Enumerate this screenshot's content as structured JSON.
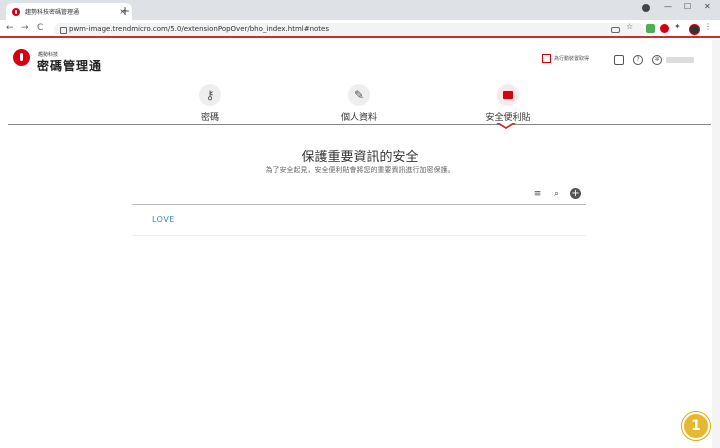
{
  "browser": {
    "tab_title": "趨勢科技密碼管理通",
    "tab_close": "×",
    "new_tab": "+",
    "url": "pwm-image.trendmicro.com/5.0/extensionPopOver/bho_index.html#notes",
    "back": "←",
    "forward": "→",
    "reload": "C",
    "minimize": "—",
    "maximize": "☐",
    "close": "✕"
  },
  "brand": {
    "small_name": "趨勢科技",
    "product_name": "密碼管理通"
  },
  "header": {
    "device_link": "為行動裝置取得"
  },
  "nav": {
    "tabs": [
      {
        "label": "密碼",
        "icon": "key-icon"
      },
      {
        "label": "個人資料",
        "icon": "pen-icon"
      },
      {
        "label": "安全便利貼",
        "icon": "secure-note-icon",
        "active": true
      }
    ]
  },
  "main": {
    "heading": "保護重要資訊的安全",
    "subheading": "為了安全起見，安全便利貼會將您的重要資訊進行加密保護。",
    "notes": [
      {
        "title": "LOVE"
      }
    ]
  },
  "badge": {
    "number": "1"
  },
  "colors": {
    "brand_red": "#d7000f",
    "link_blue": "#3a8bbb",
    "badge_gold": "#e8b730"
  }
}
